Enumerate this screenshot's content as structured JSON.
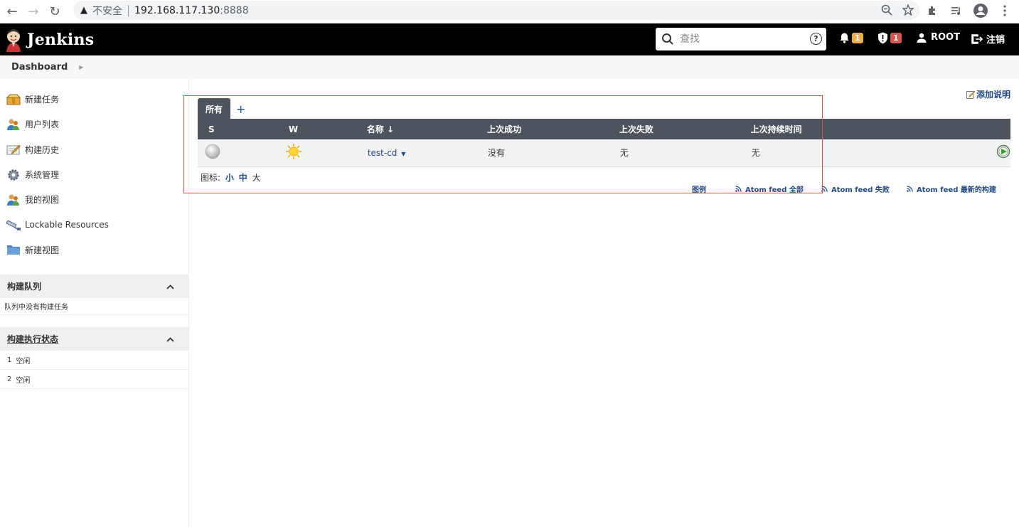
{
  "browser": {
    "security_warning": "不安全",
    "url_host": "192.168.117.130",
    "url_port": ":8888"
  },
  "header": {
    "brand": "Jenkins",
    "search_placeholder": "查找",
    "notifications_count": "1",
    "security_count": "1",
    "user": "ROOT",
    "logout": "注销"
  },
  "breadcrumb": {
    "root": "Dashboard"
  },
  "sidebar": {
    "tasks": [
      {
        "label": "新建任务"
      },
      {
        "label": "用户列表"
      },
      {
        "label": "构建历史"
      },
      {
        "label": "系统管理"
      },
      {
        "label": "我的视图"
      },
      {
        "label": "Lockable Resources"
      },
      {
        "label": "新建视图"
      }
    ],
    "build_queue": {
      "title": "构建队列",
      "empty_text": "队列中没有构建任务"
    },
    "executors": {
      "title": "构建执行状态",
      "rows": [
        {
          "num": "1",
          "status": "空闲"
        },
        {
          "num": "2",
          "status": "空闲"
        }
      ]
    }
  },
  "main": {
    "add_description": "添加说明",
    "tabs": [
      {
        "label": "所有"
      }
    ],
    "add_tab": "+",
    "columns": [
      "S",
      "W",
      "名称 ↓",
      "上次成功",
      "上次失败",
      "上次持续时间"
    ],
    "jobs": [
      {
        "name": "test-cd",
        "last_success": "没有",
        "last_failure": "无",
        "last_duration": "无"
      }
    ],
    "icon_legend": {
      "label": "图标:",
      "small": "小",
      "medium": "中",
      "large": "大"
    },
    "feeds": {
      "legend": "图例",
      "all": "Atom feed 全部",
      "failed": "Atom feed 失败",
      "latest": "Atom feed 最新的构建"
    }
  },
  "colors": {
    "accent": "#204a87",
    "header_bg": "#000000",
    "table_header": "#4d545d",
    "highlight": "#e04a4a"
  }
}
